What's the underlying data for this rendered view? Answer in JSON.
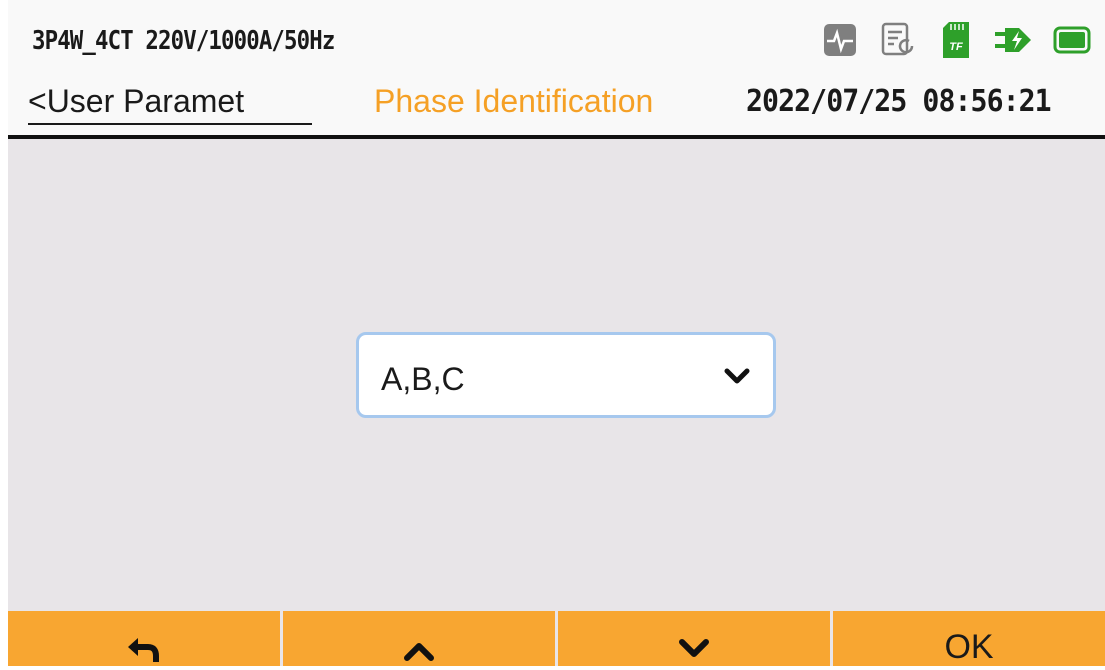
{
  "header": {
    "config": "3P4W_4CT 220V/1000A/50Hz",
    "back_label": "<User Paramet",
    "title": "Phase Identification",
    "datetime": "2022/07/25 08:56:21",
    "status_icons": [
      "waveform-icon",
      "record-icon",
      "tf-card-icon",
      "power-plug-icon",
      "battery-icon"
    ]
  },
  "phase_select": {
    "value": "A,B,C"
  },
  "footer": {
    "ok_label": "OK"
  },
  "colors": {
    "accent": "#f8a631",
    "title": "#f5a025",
    "icon_green": "#2ea02a",
    "icon_gray": "#7f7f7f"
  }
}
